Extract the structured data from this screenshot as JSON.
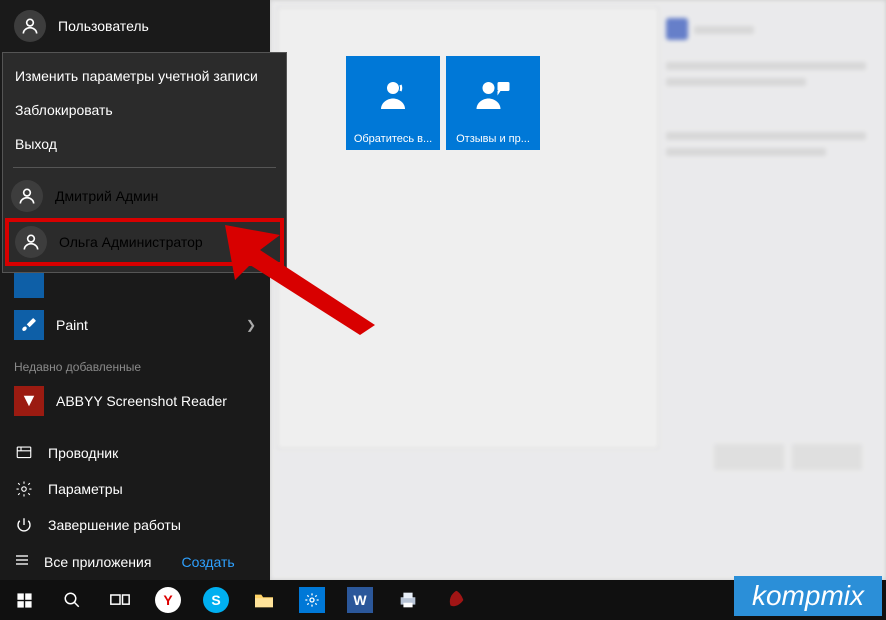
{
  "user_current": "Пользователь",
  "submenu": {
    "change_account": "Изменить параметры учетной записи",
    "lock": "Заблокировать",
    "signout": "Выход",
    "users": [
      {
        "name": "Дмитрий Админ"
      },
      {
        "name": "Ольга Администратор"
      }
    ]
  },
  "tiles": [
    {
      "label": "Обратитесь в..."
    },
    {
      "label": "Отзывы и пр..."
    }
  ],
  "most_used": {
    "paint": "Paint"
  },
  "recently_added_label": "Недавно добавленные",
  "recently_added": {
    "abbyy": "ABBYY Screenshot Reader"
  },
  "bottom": {
    "explorer": "Проводник",
    "settings": "Параметры",
    "power": "Завершение работы",
    "all_apps": "Все приложения",
    "create": "Создать"
  },
  "watermark": "kompmix"
}
